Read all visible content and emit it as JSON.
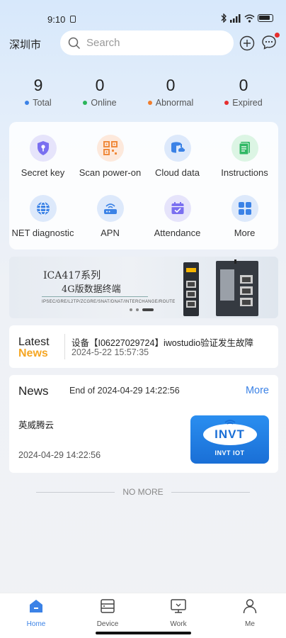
{
  "status_bar": {
    "time": "9:10",
    "battery": "",
    "icons": [
      "bluetooth-icon",
      "signal-icon",
      "wifi-icon",
      "battery-icon"
    ]
  },
  "header": {
    "city": "深圳市",
    "search": {
      "placeholder": "Search",
      "value": ""
    }
  },
  "stats": [
    {
      "value": "9",
      "label": "Total",
      "color": "#3b82e6"
    },
    {
      "value": "0",
      "label": "Online",
      "color": "#2bb55a"
    },
    {
      "value": "0",
      "label": "Abnormal",
      "color": "#f07d2c"
    },
    {
      "value": "0",
      "label": "Expired",
      "color": "#e62e2e"
    }
  ],
  "grid": [
    {
      "label": "Secret key",
      "icon": "key-icon"
    },
    {
      "label": "Scan power-on",
      "icon": "qr-code-icon"
    },
    {
      "label": "Cloud data",
      "icon": "cloud-data-icon"
    },
    {
      "label": "Instructions",
      "icon": "document-icon"
    },
    {
      "label": "NET diagnostic",
      "icon": "globe-icon"
    },
    {
      "label": "APN",
      "icon": "router-icon"
    },
    {
      "label": "Attendance",
      "icon": "calendar-icon"
    },
    {
      "label": "More",
      "icon": "grid-icon"
    }
  ],
  "banner": {
    "title": "ICA417系列",
    "subtitle": "4G版数据终端",
    "small": "IPSEC/GRE/L2TP/ZCGRE/SNAT/DNAT/INTERCHANGE/ROUTE"
  },
  "latest": {
    "title_line1": "Latest",
    "title_line2": "News",
    "text": "设备【I06227029724】iwostudio验证发生故障",
    "time": "2024-5-22 15:57:35"
  },
  "news": {
    "heading": "News",
    "end_text": "End of 2024-04-29 14:22:56",
    "more": "More",
    "item": {
      "title": "英威腾云",
      "time": "2024-04-29 14:22:56",
      "thumb_logo": "INVT",
      "thumb_sub": "INVT IOT"
    }
  },
  "no_more": "NO MORE",
  "tabs": [
    {
      "label": "Home",
      "icon": "home-icon",
      "active": true
    },
    {
      "label": "Device",
      "icon": "device-icon",
      "active": false
    },
    {
      "label": "Work",
      "icon": "work-icon",
      "active": false
    },
    {
      "label": "Me",
      "icon": "user-icon",
      "active": false
    }
  ]
}
